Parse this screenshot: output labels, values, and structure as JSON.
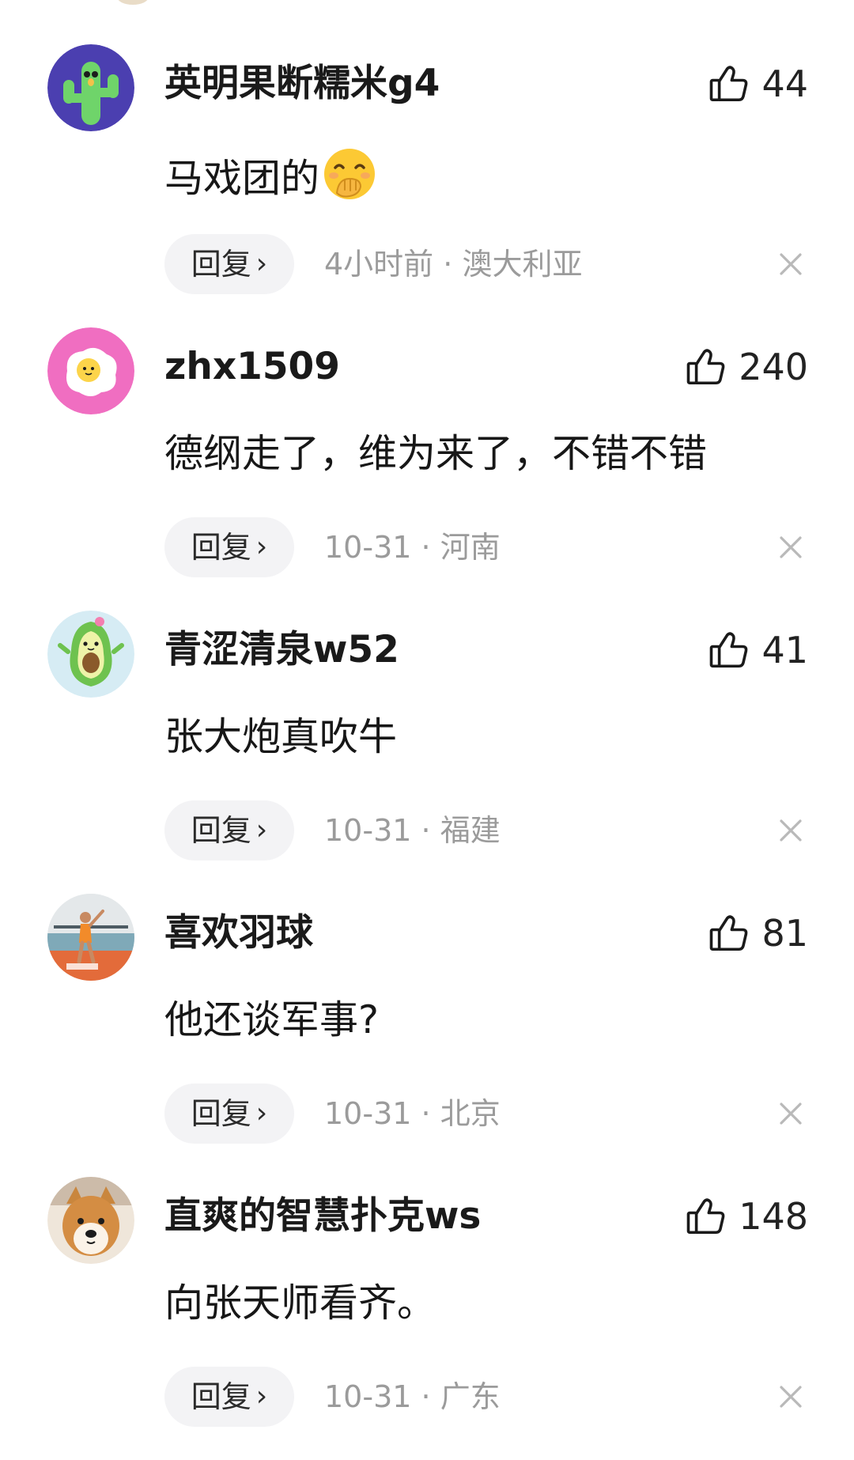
{
  "comments": [
    {
      "username": "英明果断糯米g4",
      "likes": "44",
      "text": "马戏团的",
      "emoji": "face-with-hand-over-mouth",
      "reply_label": "回复",
      "time": "4小时前",
      "separator": "·",
      "location": "澳大利亚",
      "avatar": "cactus-avatar"
    },
    {
      "username": "zhx1509",
      "likes": "240",
      "text": "德纲走了，维为来了，不错不错",
      "reply_label": "回复",
      "time": "10-31",
      "separator": "·",
      "location": "河南",
      "avatar": "fried-egg-avatar"
    },
    {
      "username": "青涩清泉w52",
      "likes": "41",
      "text": "张大炮真吹牛",
      "reply_label": "回复",
      "time": "10-31",
      "separator": "·",
      "location": "福建",
      "avatar": "avocado-avatar"
    },
    {
      "username": "喜欢羽球",
      "likes": "81",
      "text": "他还谈军事?",
      "reply_label": "回复",
      "time": "10-31",
      "separator": "·",
      "location": "北京",
      "avatar": "badminton-photo-avatar"
    },
    {
      "username": "直爽的智慧扑克ws",
      "likes": "148",
      "text": "向张天师看齐。",
      "reply_label": "回复",
      "time": "10-31",
      "separator": "·",
      "location": "广东",
      "avatar": "shiba-dog-avatar"
    }
  ],
  "icons": {
    "like": "thumbs-up-icon",
    "close": "close-icon",
    "reply_arrow": "chevron-right-icon"
  },
  "colors": {
    "meta_text": "#9b9b9b",
    "reply_pill": "#f3f3f5"
  }
}
